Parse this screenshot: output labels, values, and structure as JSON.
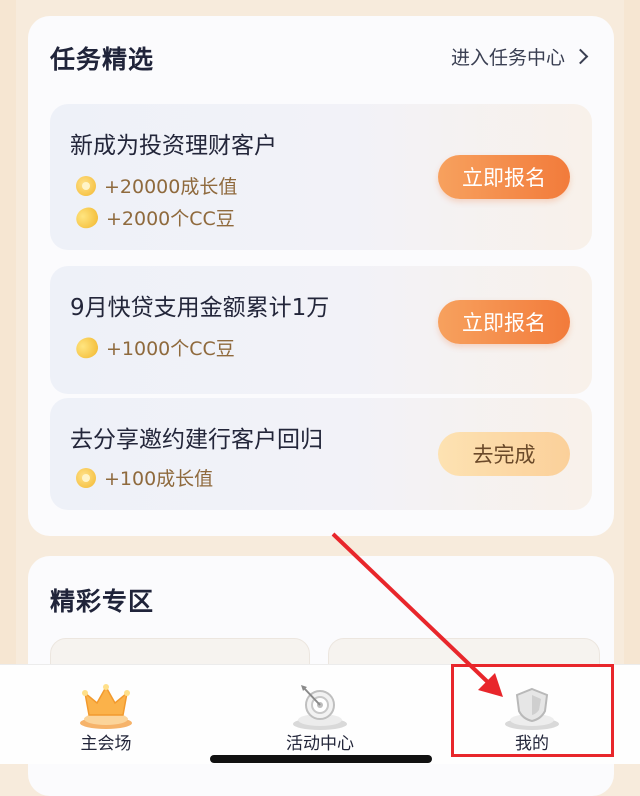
{
  "tasks_section": {
    "title": "任务精选",
    "more_link": "进入任务中心",
    "items": [
      {
        "title": "新成为投资理财客户",
        "rewards": [
          {
            "icon": "growth-coin-icon",
            "text": "+20000成长值"
          },
          {
            "icon": "cc-bean-icon",
            "text": "+2000个CC豆"
          }
        ],
        "button": "立即报名",
        "button_style": "primary"
      },
      {
        "title": "9月快贷支用金额累计1万",
        "rewards": [
          {
            "icon": "cc-bean-icon",
            "text": "+1000个CC豆"
          }
        ],
        "button": "立即报名",
        "button_style": "primary"
      },
      {
        "title": "去分享邀约建行客户回归",
        "rewards": [
          {
            "icon": "growth-coin-icon",
            "text": "+100成长值"
          }
        ],
        "button": "去完成",
        "button_style": "secondary"
      }
    ]
  },
  "featured_section": {
    "title": "精彩专区"
  },
  "tabbar": {
    "tabs": [
      {
        "label": "主会场",
        "icon": "crown-icon"
      },
      {
        "label": "活动中心",
        "icon": "target-icon"
      },
      {
        "label": "我的",
        "icon": "shield-icon"
      }
    ]
  },
  "colors": {
    "primary_button": "#f27b3b",
    "secondary_button": "#fbd09a",
    "reward_text": "#8f6a3d",
    "annotation_red": "#e8262b"
  }
}
